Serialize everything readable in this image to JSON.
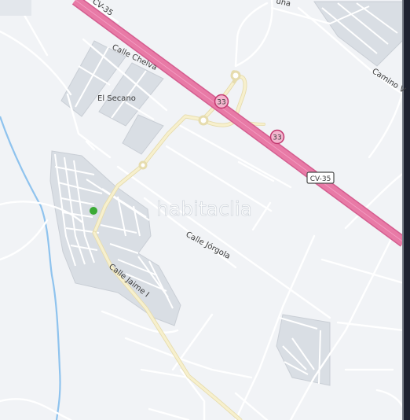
{
  "map": {
    "streets": {
      "calle_chelva": "Calle  Chelva",
      "calle_jorgola": "Calle  Jórgola",
      "calle_jaime_i": "Calle  Jaime  I",
      "camino": "Camino  V",
      "top_partial": "una"
    },
    "places": {
      "el_secano": "El Secano"
    },
    "highway": {
      "name": "CV-35",
      "shield_top": "CV-35",
      "exit_a": "33",
      "exit_b": "33"
    },
    "watermark": "habitaclia",
    "colors": {
      "background": "#f1f3f6",
      "highway": "#e87aa6",
      "main_road": "#f5eec6",
      "built_area": "#d9dee4",
      "river": "#8fc3ee",
      "location_marker": "#3aaa35"
    },
    "marker": {
      "type": "location-dot"
    }
  }
}
